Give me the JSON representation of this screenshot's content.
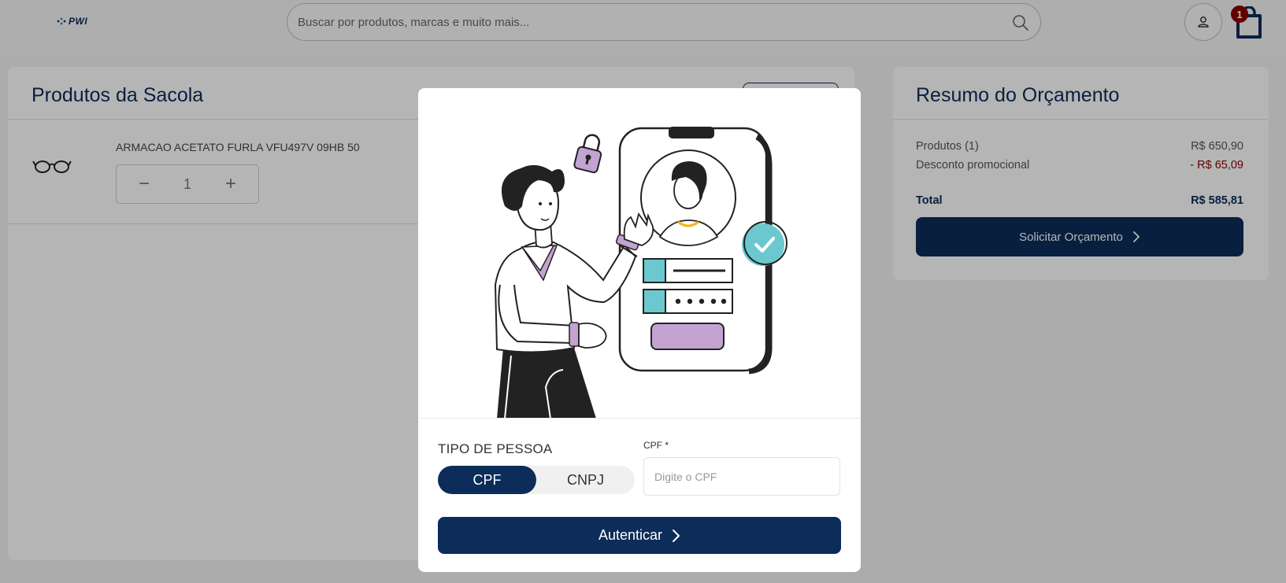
{
  "header": {
    "logo_text": "PWI",
    "search_placeholder": "Buscar por produtos, marcas e muito mais...",
    "cart_count": "1"
  },
  "bag": {
    "title": "Produtos da Sacola",
    "product": {
      "name": "ARMACAO ACETATO FURLA VFU497V 09HB 50",
      "quantity": "1",
      "minus": "−",
      "plus": "+"
    }
  },
  "summary": {
    "title": "Resumo do Orçamento",
    "rows": [
      {
        "label": "Produtos (1)",
        "value": "R$ 650,90"
      },
      {
        "label": "Desconto promocional",
        "value": "- R$ 65,09"
      },
      {
        "label": "Total",
        "value": "R$ 585,81"
      }
    ],
    "button_label": "Solicitar Orçamento"
  },
  "modal": {
    "tipo_label": "TIPO DE PESSOA",
    "options": [
      "CPF",
      "CNPJ"
    ],
    "selected": "CPF",
    "cpf_label": "CPF *",
    "cpf_placeholder": "Digite o CPF",
    "cpf_value": "",
    "submit_label": "Autenticar"
  },
  "colors": {
    "primary": "#0c2c5a",
    "discount": "#8b0000",
    "badge": "#8b0000",
    "accent_teal": "#6cc8cf",
    "accent_purple": "#c3a3d1"
  }
}
